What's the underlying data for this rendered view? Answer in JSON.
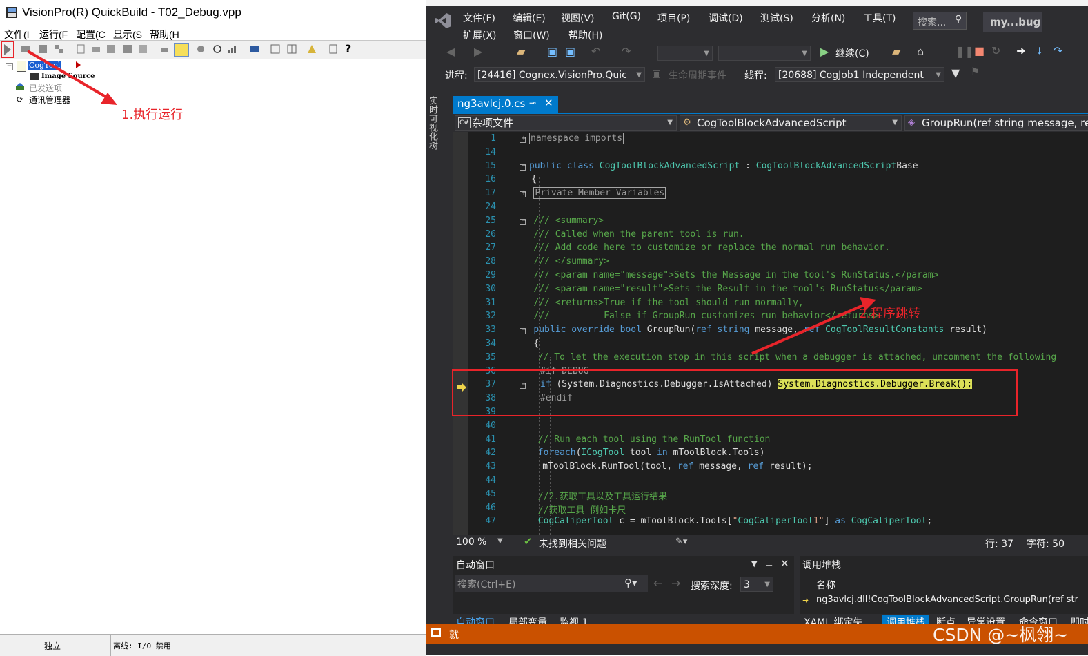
{
  "visionpro": {
    "title": "VisionPro(R) QuickBuild - T02_Debug.vpp",
    "menu": [
      "文件(I",
      "运行(F",
      "配置(C",
      "显示(S",
      "帮助(H"
    ],
    "tree": {
      "root": "CogTool",
      "child1": "Image Source",
      "child2": "已发送项",
      "child3": "通讯管理器"
    },
    "status": {
      "mode": "独立",
      "io": "离线: I/O 禁用"
    }
  },
  "annotations": {
    "step1": "1.执行运行",
    "step2": "2.程序跳转"
  },
  "vs": {
    "menu_row1": [
      "文件(F)",
      "编辑(E)",
      "视图(V)",
      "Git(G)",
      "项目(P)",
      "调试(D)",
      "测试(S)",
      "分析(N)",
      "工具(T)"
    ],
    "menu_row2": [
      "扩展(X)",
      "窗口(W)",
      "帮助(H)"
    ],
    "search_placeholder": "搜索...",
    "solution_name": "my...bug",
    "continue_label": "继续(C)",
    "process_label": "进程:",
    "process_value": "[24416] Cognex.VisionPro.Quic",
    "lifecycle_label": "生命周期事件",
    "thread_label": "线程:",
    "thread_value": "[20688] CogJob1 Independent",
    "side_tab": "实时可视化树",
    "file_tab": "ng3avlcj.0.cs",
    "nav_project": "杂项文件",
    "nav_class": "CogToolBlockAdvancedScript",
    "nav_member": "GroupRun(ref string message, re",
    "zoom": "100 %",
    "issues": "未找到相关问题",
    "line_info": "行: 37",
    "char_info": "字符: 50",
    "autos": {
      "title": "自动窗口",
      "search_placeholder": "搜索(Ctrl+E)",
      "depth_label": "搜索深度:",
      "depth_value": "3",
      "tabs": [
        "自动窗口",
        "局部变量",
        "监视 1"
      ]
    },
    "callstack": {
      "title": "调用堆栈",
      "col_name": "名称",
      "row": "ng3avlcj.dll!CogToolBlockAdvancedScript.GroupRun(ref str",
      "tabs": [
        "XAML 绑定失...",
        "调用堆栈",
        "断点",
        "异常设置",
        "命令窗口",
        "即时"
      ]
    },
    "status_text": "就"
  },
  "code": {
    "lines": [
      {
        "n": "1",
        "t": "namespace imports"
      },
      {
        "n": "14",
        "t": ""
      },
      {
        "n": "15",
        "t": "public class CogToolBlockAdvancedScript : CogToolBlockAdvancedScriptBase"
      },
      {
        "n": "16",
        "t": "{"
      },
      {
        "n": "17",
        "t": "Private Member Variables"
      },
      {
        "n": "24",
        "t": ""
      },
      {
        "n": "25",
        "t": "/// <summary>"
      },
      {
        "n": "26",
        "t": "/// Called when the parent tool is run."
      },
      {
        "n": "27",
        "t": "/// Add code here to customize or replace the normal run behavior."
      },
      {
        "n": "28",
        "t": "/// </summary>"
      },
      {
        "n": "29",
        "t": "/// <param name=\"message\">Sets the Message in the tool's RunStatus.</param>"
      },
      {
        "n": "30",
        "t": "/// <param name=\"result\">Sets the Result in the tool's RunStatus</param>"
      },
      {
        "n": "31",
        "t": "/// <returns>True if the tool should run normally,"
      },
      {
        "n": "32",
        "t": "///          False if GroupRun customizes run behavior</returns>"
      },
      {
        "n": "33",
        "t": "public override bool GroupRun(ref string message, ref CogToolResultConstants result)"
      },
      {
        "n": "34",
        "t": "{"
      },
      {
        "n": "35",
        "t": "// To let the execution stop in this script when a debugger is attached, uncomment the following"
      },
      {
        "n": "36",
        "t": "#if DEBUG"
      },
      {
        "n": "37",
        "t": "if (System.Diagnostics.Debugger.IsAttached) System.Diagnostics.Debugger.Break();"
      },
      {
        "n": "38",
        "t": "#endif"
      },
      {
        "n": "39",
        "t": ""
      },
      {
        "n": "40",
        "t": ""
      },
      {
        "n": "41",
        "t": "// Run each tool using the RunTool function"
      },
      {
        "n": "42",
        "t": "foreach(ICogTool tool in mToolBlock.Tools)"
      },
      {
        "n": "43",
        "t": "mToolBlock.RunTool(tool, ref message, ref result);"
      },
      {
        "n": "44",
        "t": ""
      },
      {
        "n": "45",
        "t": "//2.获取工具以及工具运行结果"
      },
      {
        "n": "46",
        "t": "//获取工具 例如卡尺"
      },
      {
        "n": "47",
        "t": "CogCaliperTool c = mToolBlock.Tools[\"CogCaliperTool1\"] as CogCaliperTool;"
      }
    ]
  },
  "watermark": "CSDN @~枫翎~",
  "colors": {
    "annotation_red": "#e8242a",
    "vs_accent": "#007acc",
    "vs_status_orange": "#ca5100",
    "highlight": "#dbe058"
  }
}
